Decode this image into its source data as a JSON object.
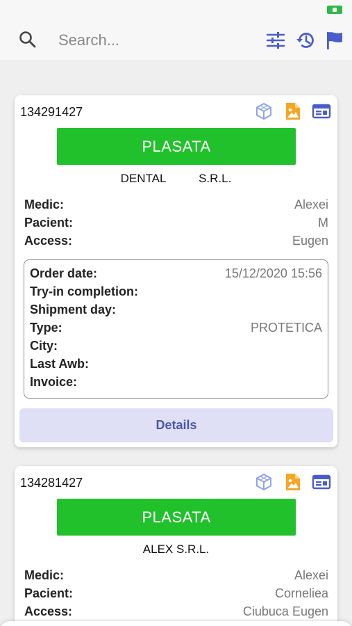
{
  "colors": {
    "accent_blue": "#4a5ccc",
    "status_green": "#21c12c",
    "icon_orange": "#f5a623",
    "icon_light_blue": "#8fa4e8",
    "details_bg": "#dfe0f6"
  },
  "search": {
    "placeholder": "Search..."
  },
  "header_icons": [
    "search-icon",
    "filter-sliders-icon",
    "history-icon",
    "flag-icon"
  ],
  "orders": [
    {
      "order_number": "134291427",
      "status": "PLASATA",
      "company": "DENTAL          S.R.L.",
      "icons": [
        "cube-icon",
        "image-file-icon",
        "card-view-icon"
      ],
      "info": [
        {
          "label": "Medic:",
          "value": "Alexei"
        },
        {
          "label": "Pacient:",
          "value": "M"
        },
        {
          "label": "Access:",
          "value": "Eugen"
        }
      ],
      "details": [
        {
          "label": "Order date:",
          "value": "15/12/2020 15:56"
        },
        {
          "label": "Try-in completion:",
          "value": ""
        },
        {
          "label": "Shipment day:",
          "value": ""
        },
        {
          "label": "Type:",
          "value": "PROTETICA"
        },
        {
          "label": "City:",
          "value": ""
        },
        {
          "label": "Last Awb:",
          "value": ""
        },
        {
          "label": "Invoice:",
          "value": ""
        }
      ],
      "details_button": "Details"
    },
    {
      "order_number": "134281427",
      "status": "PLASATA",
      "company": "ALEX S.R.L.",
      "icons": [
        "cube-icon",
        "image-file-icon",
        "card-view-icon"
      ],
      "info": [
        {
          "label": "Medic:",
          "value": "Alexei"
        },
        {
          "label": "Pacient:",
          "value": "Corneliea"
        },
        {
          "label": "Access:",
          "value": "Ciubuca Eugen"
        }
      ]
    }
  ]
}
